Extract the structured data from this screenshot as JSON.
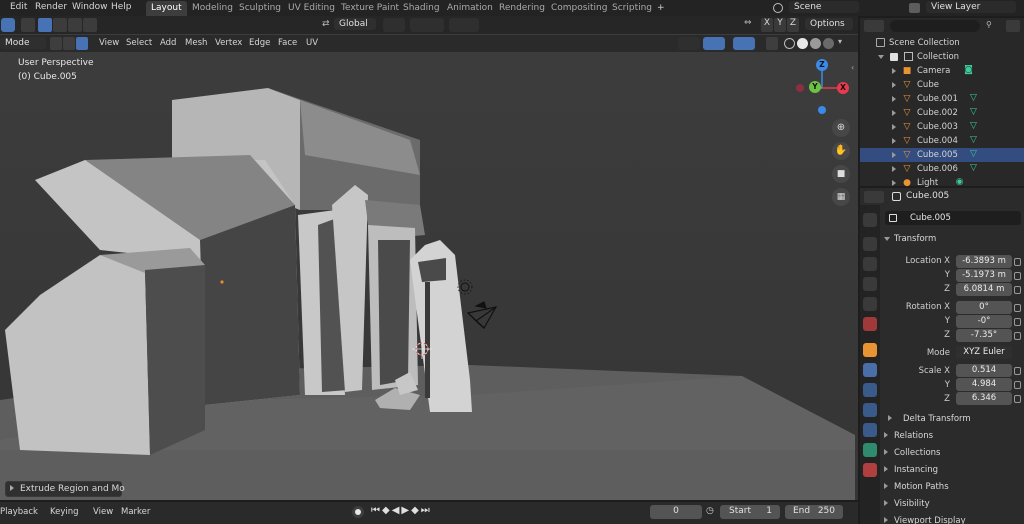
{
  "topbar": {
    "menus": [
      "Edit",
      "Render",
      "Window",
      "Help"
    ],
    "workspaces": [
      "Layout",
      "Modeling",
      "Sculpting",
      "UV Editing",
      "Texture Paint",
      "Shading",
      "Animation",
      "Rendering",
      "Compositing",
      "Scripting"
    ],
    "active_workspace": "Layout",
    "add_tab": "+",
    "scene": "Scene",
    "view_layer": "View Layer"
  },
  "viewport_header": {
    "mode": "Mode",
    "menus": [
      "View",
      "Select",
      "Add",
      "Mesh",
      "Vertex",
      "Edge",
      "Face",
      "UV"
    ],
    "orientation": "Global",
    "options": "Options",
    "axes": [
      "X",
      "Y",
      "Z"
    ]
  },
  "viewport": {
    "perspective": "User Perspective",
    "object": "(0) Cube.005",
    "last_op": "Extrude Region and Mo",
    "gizmo": {
      "x": "X",
      "y": "Y",
      "z": "Z"
    }
  },
  "outliner": {
    "root": "Scene Collection",
    "collection": "Collection",
    "items": [
      {
        "name": "Camera",
        "type": "camera"
      },
      {
        "name": "Cube",
        "type": "mesh"
      },
      {
        "name": "Cube.001",
        "type": "mesh"
      },
      {
        "name": "Cube.002",
        "type": "mesh"
      },
      {
        "name": "Cube.003",
        "type": "mesh"
      },
      {
        "name": "Cube.004",
        "type": "mesh"
      },
      {
        "name": "Cube.005",
        "type": "mesh",
        "selected": true
      },
      {
        "name": "Cube.006",
        "type": "mesh"
      },
      {
        "name": "Light",
        "type": "light"
      }
    ]
  },
  "properties": {
    "object_name": "Cube.005",
    "object_field": "Cube.005",
    "transform_title": "Transform",
    "location_label": "Location X",
    "location": {
      "x": "-6.3893 m",
      "y": "-5.1973 m",
      "z": "6.0814 m"
    },
    "rotation_label": "Rotation X",
    "rotation": {
      "x": "0°",
      "y": "-0°",
      "z": "-7.35°"
    },
    "mode_label": "Mode",
    "rotation_mode": "XYZ Euler",
    "scale_label": "Scale X",
    "scale": {
      "x": "0.514",
      "y": "4.984",
      "z": "6.346"
    },
    "axis_y": "Y",
    "axis_z": "Z",
    "delta": "Delta Transform",
    "sections": [
      "Relations",
      "Collections",
      "Instancing",
      "Motion Paths",
      "Visibility",
      "Viewport Display"
    ]
  },
  "timeline": {
    "menus": [
      "Playback",
      "Keying",
      "View",
      "Marker"
    ],
    "current_frame": "0",
    "start_label": "Start",
    "start": "1",
    "end_label": "End",
    "end": "250"
  },
  "colors": {
    "accent": "#4772b3",
    "selected_row": "#334d80",
    "mesh_icon": "#e89433",
    "data_icon": "#3fc99b",
    "axis_x": "#e83a4f",
    "axis_y": "#6ec243",
    "axis_z": "#3c8ae8"
  }
}
